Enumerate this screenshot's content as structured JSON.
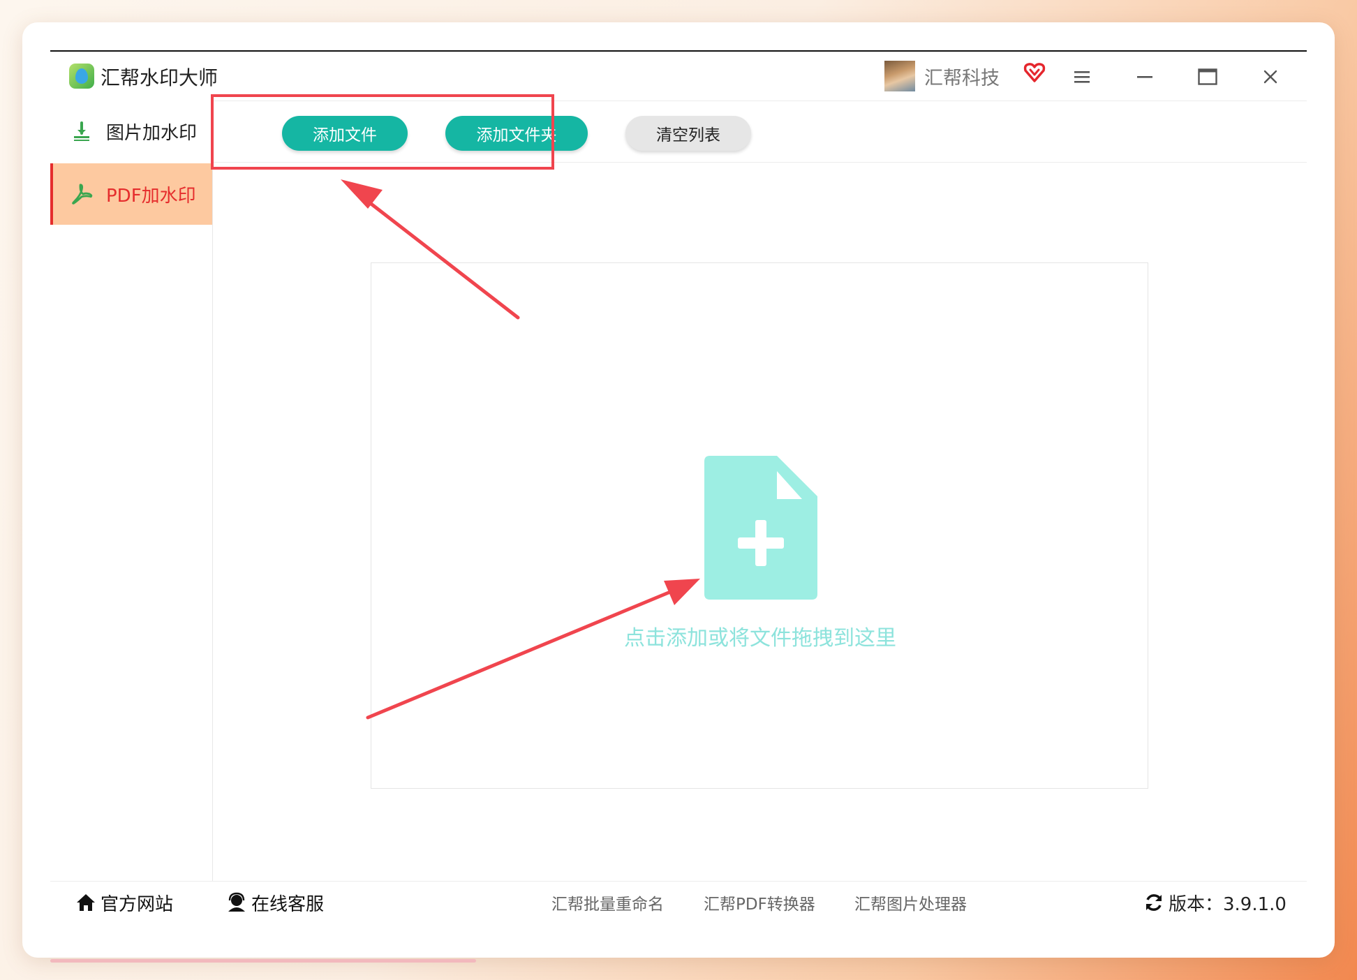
{
  "app": {
    "title": "汇帮水印大师",
    "user_name": "汇帮科技",
    "icons": [
      "logo-icon",
      "avatar",
      "vip-heart-icon",
      "menu-icon",
      "minimize-icon",
      "maximize-icon",
      "close-icon"
    ]
  },
  "sidebar": {
    "items": [
      {
        "label": "图片加水印",
        "icon": "image-watermark-icon",
        "active": false
      },
      {
        "label": "PDF加水印",
        "icon": "pdf-icon",
        "active": true
      }
    ]
  },
  "toolbar": {
    "add_file_label": "添加文件",
    "add_folder_label": "添加文件夹",
    "clear_list_label": "清空列表"
  },
  "dropzone": {
    "hint": "点击添加或将文件拖拽到这里",
    "icon": "file-add-icon"
  },
  "footer": {
    "official_site": "官方网站",
    "online_service": "在线客服",
    "links": [
      "汇帮批量重命名",
      "汇帮PDF转换器",
      "汇帮图片处理器"
    ],
    "version": "版本：3.9.1.0"
  },
  "colors": {
    "accent_teal": "#15b6a3",
    "active_tab_bg": "#fdc9a0",
    "active_tab_text": "#e52d2d",
    "annotation_red": "#f0454e",
    "drop_icon": "#9deee3"
  }
}
